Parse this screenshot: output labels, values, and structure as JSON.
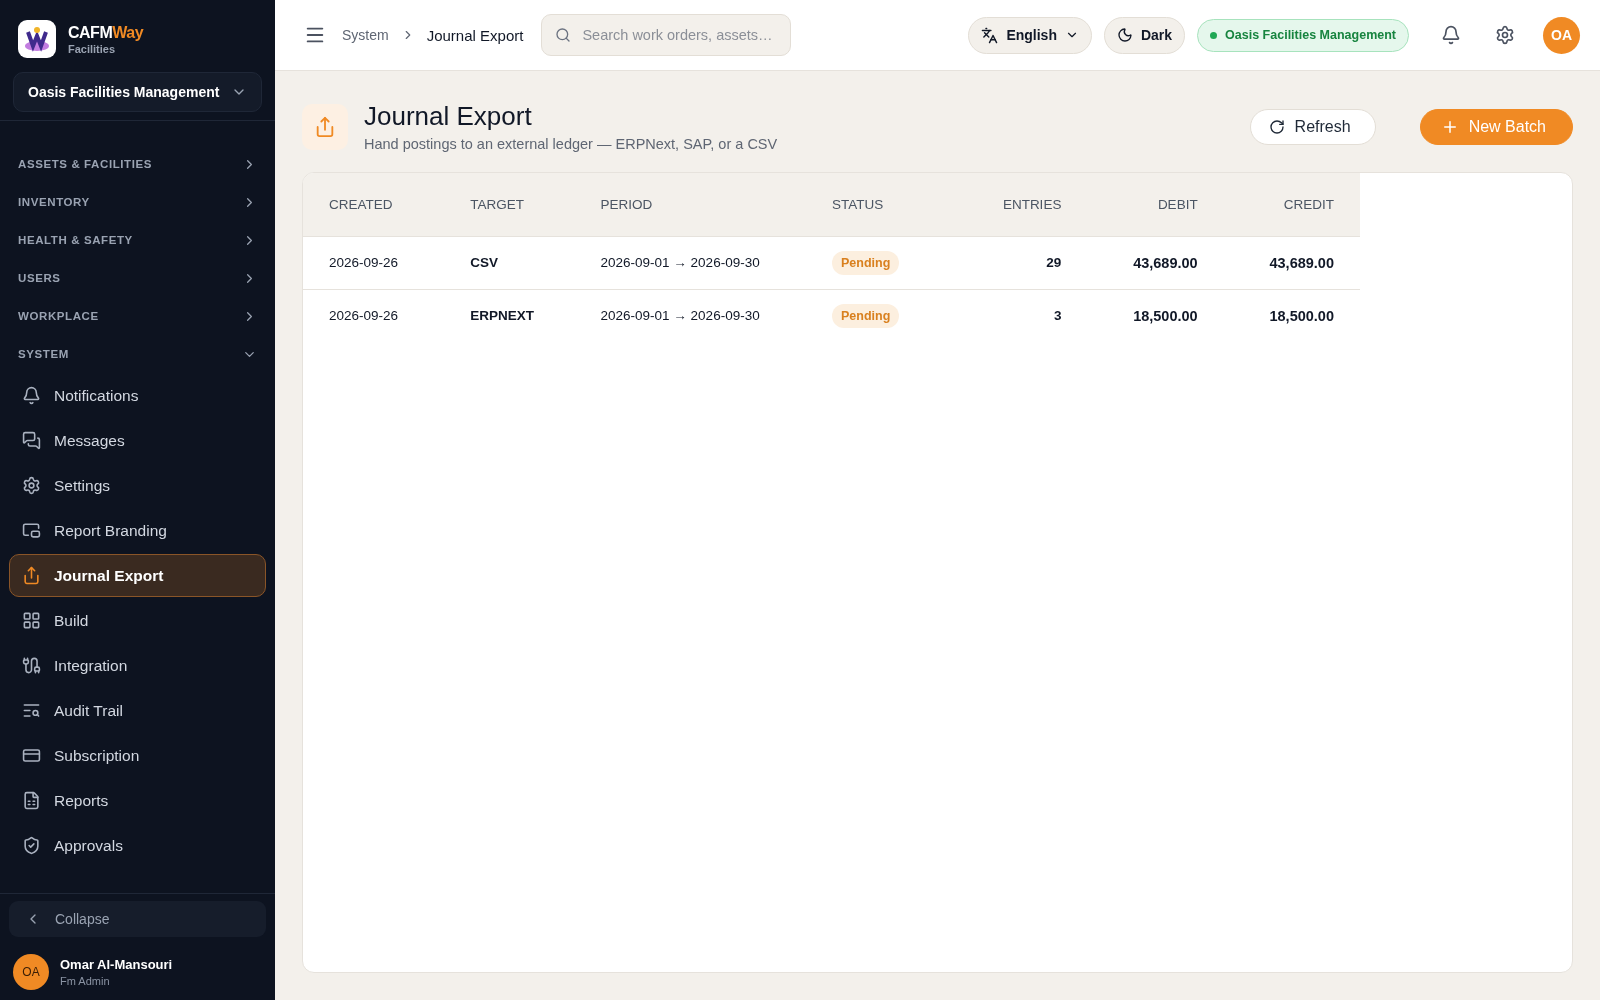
{
  "brand": {
    "name_main": "CAFM",
    "name_accent": "Way",
    "subtitle": "Facilities"
  },
  "org_selector": {
    "value": "Oasis Facilities Management"
  },
  "sidebar": {
    "sections": [
      {
        "label": "ASSETS & FACILITIES",
        "expanded": false
      },
      {
        "label": "INVENTORY",
        "expanded": false
      },
      {
        "label": "HEALTH & SAFETY",
        "expanded": false
      },
      {
        "label": "USERS",
        "expanded": false
      },
      {
        "label": "WORKPLACE",
        "expanded": false
      },
      {
        "label": "SYSTEM",
        "expanded": true
      }
    ],
    "items": [
      {
        "label": "Notifications",
        "selected": false
      },
      {
        "label": "Messages",
        "selected": false
      },
      {
        "label": "Settings",
        "selected": false
      },
      {
        "label": "Report Branding",
        "selected": false
      },
      {
        "label": "Journal Export",
        "selected": true
      },
      {
        "label": "Build",
        "selected": false
      },
      {
        "label": "Integration",
        "selected": false
      },
      {
        "label": "Audit Trail",
        "selected": false
      },
      {
        "label": "Subscription",
        "selected": false
      },
      {
        "label": "Reports",
        "selected": false
      },
      {
        "label": "Approvals",
        "selected": false
      }
    ],
    "collapse": "Collapse",
    "user": {
      "initials": "OA",
      "name": "Omar Al-Mansouri",
      "role": "Fm Admin"
    }
  },
  "topbar": {
    "breadcrumb": [
      "System",
      "Journal Export"
    ],
    "search": {
      "placeholder": "Search work orders, assets…"
    },
    "language": "English",
    "theme": "Dark",
    "org_badge": "Oasis Facilities Management",
    "avatar": "OA"
  },
  "page": {
    "title": "Journal Export",
    "subtitle": "Hand postings to an external ledger — ERPNext, SAP, or a CSV",
    "buttons": [
      {
        "kind": "secondary",
        "label": "Refresh"
      },
      {
        "kind": "primary",
        "label": "New Batch"
      }
    ]
  },
  "table": {
    "columns": [
      "CREATED",
      "TARGET",
      "PERIOD",
      "STATUS",
      "ENTRIES",
      "DEBIT",
      "CREDIT"
    ],
    "rows": [
      {
        "created": "2026-09-26",
        "target": "CSV",
        "period": "2026-09-01 → 2026-09-30",
        "status": "Pending",
        "entries": "29",
        "debit": "43,689.00",
        "credit": "43,689.00"
      },
      {
        "created": "2026-09-26",
        "target": "ERPNEXT",
        "period": "2026-09-01 → 2026-09-30",
        "status": "Pending",
        "entries": "3",
        "debit": "18,500.00",
        "credit": "18,500.00"
      }
    ]
  }
}
